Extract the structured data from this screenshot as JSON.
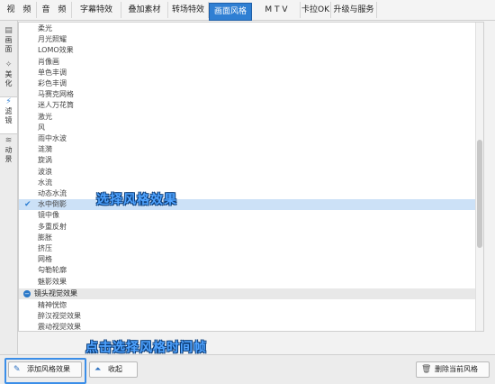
{
  "tabs": [
    {
      "label": "视　频"
    },
    {
      "label": "音　频"
    },
    {
      "label": "字幕特效"
    },
    {
      "label": "叠加素材"
    },
    {
      "label": "转场特效"
    },
    {
      "label": "画面风格"
    },
    {
      "label": "M T V"
    },
    {
      "label": "卡拉OK"
    },
    {
      "label": "升级与服务"
    }
  ],
  "side_tabs": [
    {
      "label": "画面"
    },
    {
      "label": "美化"
    },
    {
      "label": "滤镜"
    },
    {
      "label": "动景"
    }
  ],
  "list": {
    "items": [
      "柔光",
      "月光照耀",
      "LOMO效果",
      "肖像画",
      "单色丰调",
      "彩色丰调",
      "马赛克网格",
      "迷人万花筒",
      "激光",
      "风",
      "雨中水波",
      "涟漪",
      "旋涡",
      "波浪",
      "水流",
      "动态水流",
      "水中倒影",
      "镜中像",
      "多重反射",
      "膨胀",
      "挤压",
      "网格",
      "勾勒轮廓",
      "魅影效果"
    ],
    "selected": "水中倒影",
    "group_label": "镜头视觉效果",
    "group_items": [
      "精神恍惚",
      "醉汉视觉效果",
      "震动视觉效果"
    ]
  },
  "annotations": {
    "select_style": "选择风格效果",
    "click_after": "点击选择风格时间帧"
  },
  "buttons": {
    "add_style": "添加风格效果",
    "collapse": "收起",
    "delete_style": "删除当前风格"
  }
}
